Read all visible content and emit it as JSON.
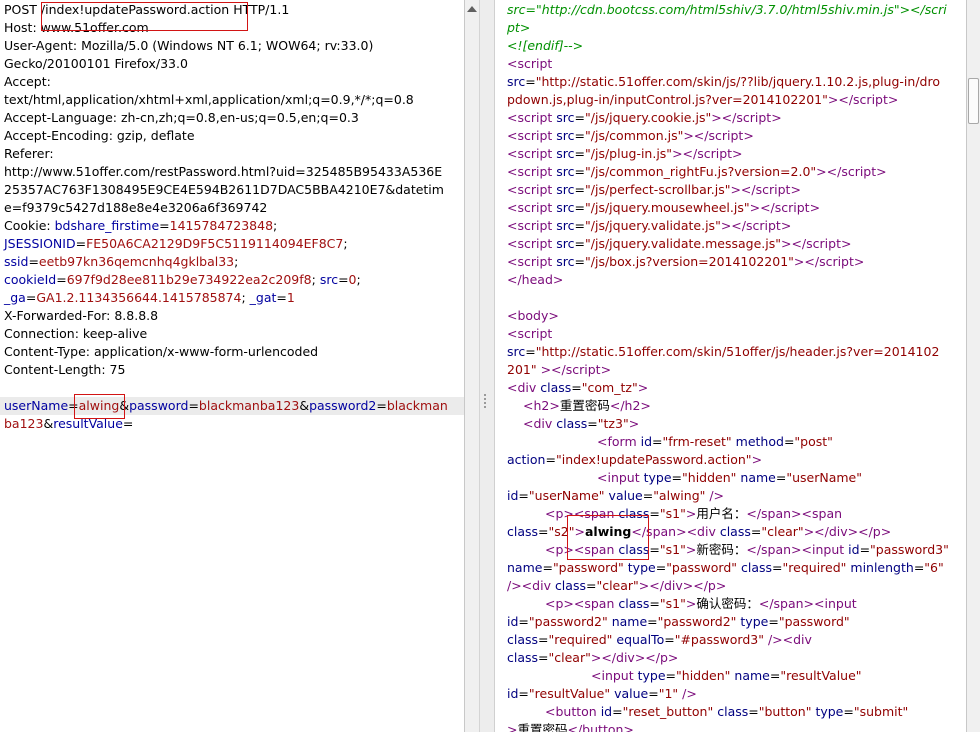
{
  "request": {
    "line1": "POST /index!updatePassword.action HTTP/1.1",
    "host": "Host: www.51offer.com",
    "ua1": "User-Agent: Mozilla/5.0 (Windows NT 6.1; WOW64; rv:33.0)",
    "ua2": "Gecko/20100101 Firefox/33.0",
    "accept1": "Accept:",
    "accept2": "text/html,application/xhtml+xml,application/xml;q=0.9,*/*;q=0.8",
    "lang": "Accept-Language: zh-cn,zh;q=0.8,en-us;q=0.5,en;q=0.3",
    "enc": "Accept-Encoding: gzip, deflate",
    "referer": "Referer:",
    "ref1": "http://www.51offer.com/restPassword.html?uid=325485B95433A536E",
    "ref2": "25357AC763F1308495E9CE4E594B2611D7DAC5BBA4210E7&datetim",
    "ref3": "e=f9379c5427d188e8e4e3206a6f369742",
    "cookie_label": "Cookie: ",
    "c1n": "bdshare_firstime",
    "c1v": "1415784723848",
    "c2n": "JSESSIONID",
    "c2v": "FE50A6CA2129D9F5C5119114094EF8C7",
    "c3n": "ssid",
    "c3v": "eetb97kn36qemcnhq4gklbal33",
    "c4n": "cookieId",
    "c4v": "697f9d28ee811b29e734922ea2c209f8",
    "c5n": "src",
    "c5v": "0",
    "c6n": "_ga",
    "c6v": "GA1.2.1134356644.1415785874",
    "c7n": "_gat",
    "c7v": "1",
    "xff": "X-Forwarded-For: 8.8.8.8",
    "conn": "Connection: keep-alive",
    "ctype": "Content-Type: application/x-www-form-urlencoded",
    "clen": "Content-Length: 75",
    "body": {
      "p1n": "userName",
      "p1v": "alwing",
      "p2n": "password",
      "p2v": "blackmanba123",
      "p3n": "password2",
      "p3v1": "blackman",
      "p3v2": "ba123",
      "p4n": "resultValue"
    }
  },
  "response": {
    "l1": "src=\"http://cdn.bootcss.com/html5shiv/3.7.0/html5shiv.min.js\"></scri",
    "l2": "pt>",
    "l3": "<![endif]-->",
    "l4": "<script",
    "l5a": "src",
    "l5b": "\"http://static.51offer.com/skin/js/??lib/jquery.1.10.2.js,plug-in/dro",
    "l6": "pdown.js,plug-in/inputControl.js?ver=2014102201\"",
    "scripts": [
      "\"/js/jquery.cookie.js\"",
      "\"/js/common.js\"",
      "\"/js/plug-in.js\"",
      "\"/js/common_rightFu.js?version=2.0\"",
      "\"/js/perfect-scrollbar.js\"",
      "\"/js/jquery.mousewheel.js\"",
      "\"/js/jquery.validate.js\"",
      "\"/js/jquery.validate.message.js\"",
      "\"/js/box.js?version=2014102201\""
    ],
    "head_close": "</head>",
    "body_open": "<body>",
    "hdr1": "\"http://static.51offer.com/skin/51offer/js/header.js?ver=2014102",
    "hdr2": "201\"",
    "div_comtz": "\"com_tz\"",
    "h2_text": "重置密码",
    "div_tz3": "\"tz3\"",
    "form_id": "\"frm-reset\"",
    "form_method": "\"post\"",
    "form_action": "\"index!updatePassword.action\"",
    "in1_type": "\"hidden\"",
    "in1_name": "\"userName\"",
    "in1_id": "\"userName\"",
    "in1_value": "\"alwing\"",
    "s1": "\"s1\"",
    "lbl_user": "用户名：",
    "s2": "\"s2\"",
    "user_val": "alwing",
    "clear": "\"clear\"",
    "lbl_newpwd": "新密码：",
    "pw3_id": "\"password3\"",
    "pw_name": "\"password\"",
    "pw_type": "\"password\"",
    "required": "\"required\"",
    "minlen": "\"6\"",
    "lbl_confirm": "确认密码：",
    "pw2_id": "\"password2\"",
    "pw2_name": "\"password2\"",
    "eqto": "\"#password3\"",
    "rv_type": "\"hidden\"",
    "rv_name": "\"resultValue\"",
    "rv_id": "\"resultValue\"",
    "rv_value": "\"1\"",
    "btn_id": "\"reset_button\"",
    "btn_class": "\"button\"",
    "btn_type": "\"submit\"",
    "btn_text": "重置密码"
  }
}
